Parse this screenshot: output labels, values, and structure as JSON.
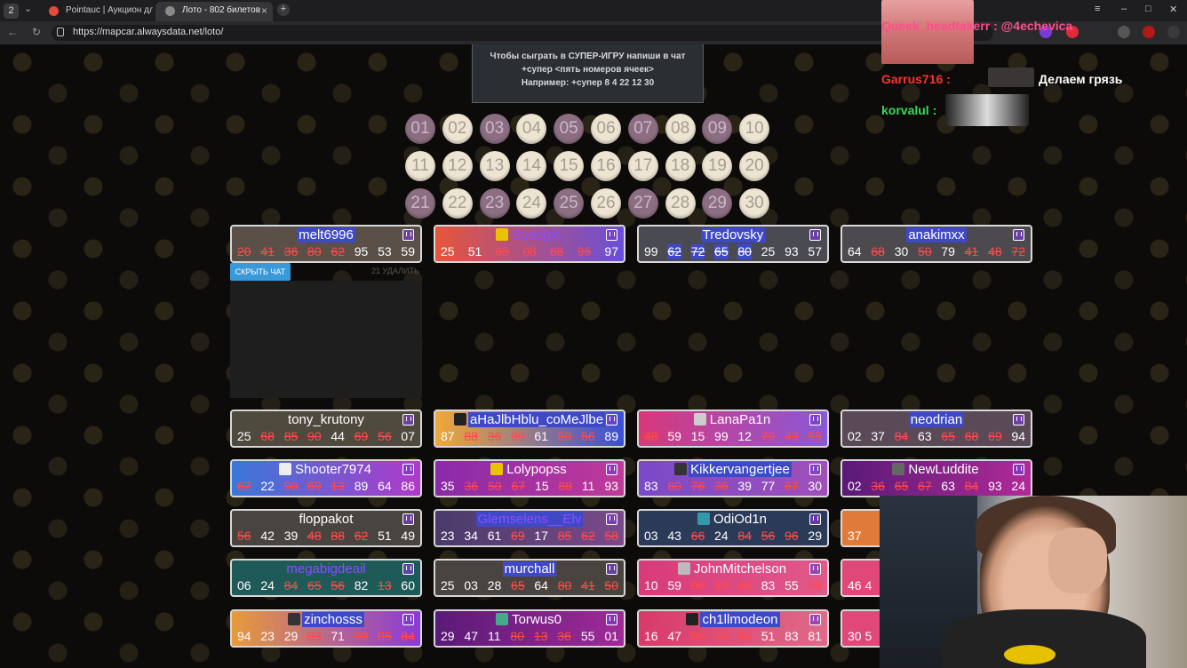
{
  "browser": {
    "tabs": [
      {
        "label": "Pointauc | Аукцион для с",
        "active": false
      },
      {
        "label": "Лото - 802 билетов",
        "active": true
      }
    ],
    "url": "https://mapcar.alwaysdata.net/loto/",
    "window_badge": "2"
  },
  "banner": {
    "line1": "Чтобы сыграть в СУПЕР-ИГРУ напиши в чат",
    "line2": "+супер <пять номеров ячеек>",
    "line3": "Например: +супер 8 4 22 12 30"
  },
  "balls": [
    {
      "n": "01",
      "used": true
    },
    {
      "n": "02",
      "used": false
    },
    {
      "n": "03",
      "used": true
    },
    {
      "n": "04",
      "used": false
    },
    {
      "n": "05",
      "used": true
    },
    {
      "n": "06",
      "used": false
    },
    {
      "n": "07",
      "used": true
    },
    {
      "n": "08",
      "used": false
    },
    {
      "n": "09",
      "used": true
    },
    {
      "n": "10",
      "used": false
    },
    {
      "n": "11",
      "used": false
    },
    {
      "n": "12",
      "used": false
    },
    {
      "n": "13",
      "used": false
    },
    {
      "n": "14",
      "used": false
    },
    {
      "n": "15",
      "used": false
    },
    {
      "n": "16",
      "used": false
    },
    {
      "n": "17",
      "used": false
    },
    {
      "n": "18",
      "used": false
    },
    {
      "n": "19",
      "used": false
    },
    {
      "n": "20",
      "used": false
    },
    {
      "n": "21",
      "used": true
    },
    {
      "n": "22",
      "used": false
    },
    {
      "n": "23",
      "used": true
    },
    {
      "n": "24",
      "used": false
    },
    {
      "n": "25",
      "used": true
    },
    {
      "n": "26",
      "used": false
    },
    {
      "n": "27",
      "used": true
    },
    {
      "n": "28",
      "used": false
    },
    {
      "n": "29",
      "used": true
    },
    {
      "n": "30",
      "used": false
    }
  ],
  "chat_controls": {
    "hide_label": "СКРЫТЬ ЧАТ",
    "delete_label": "21 УДАЛИТЬ"
  },
  "cards": [
    {
      "name": "melt6996",
      "bg": "#5a5048",
      "hl": true,
      "nums": [
        [
          "20",
          "x"
        ],
        [
          "41",
          "x"
        ],
        [
          "36",
          "x"
        ],
        [
          "80",
          "x"
        ],
        [
          "62",
          "x"
        ],
        [
          "95",
          ""
        ],
        [
          "53",
          ""
        ],
        [
          "59",
          ""
        ]
      ]
    },
    {
      "name": "Buedgio",
      "bg": "linear-gradient(90deg,#e8553a,#6a4fd8)",
      "dark": true,
      "av": "#e8c400",
      "nums": [
        [
          "25",
          ""
        ],
        [
          "51",
          ""
        ],
        [
          "65",
          "x"
        ],
        [
          "08",
          "x"
        ],
        [
          "68",
          "x"
        ],
        [
          "95",
          "x"
        ],
        [
          "97",
          ""
        ]
      ]
    },
    {
      "name": "Tredovsky",
      "bg": "#4a4a52",
      "hl": true,
      "nums": [
        [
          "99",
          ""
        ],
        [
          "62",
          "u"
        ],
        [
          "72",
          "u"
        ],
        [
          "65",
          "u"
        ],
        [
          "80",
          "u"
        ],
        [
          "25",
          ""
        ],
        [
          "93",
          ""
        ],
        [
          "57",
          ""
        ]
      ]
    },
    {
      "name": "anakimxx",
      "bg": "#4c4a4f",
      "hl": true,
      "nums": [
        [
          "64",
          ""
        ],
        [
          "68",
          "x"
        ],
        [
          "30",
          ""
        ],
        [
          "50",
          "x"
        ],
        [
          "79",
          ""
        ],
        [
          "41",
          "x"
        ],
        [
          "48",
          "x"
        ],
        [
          "72",
          "x"
        ]
      ]
    },
    {
      "name": "tony_krutony",
      "bg": "#4f4a3e",
      "nums": [
        [
          "25",
          ""
        ],
        [
          "68",
          "x"
        ],
        [
          "85",
          "x"
        ],
        [
          "90",
          "x"
        ],
        [
          "44",
          ""
        ],
        [
          "69",
          "x"
        ],
        [
          "56",
          "x"
        ],
        [
          "07",
          ""
        ]
      ]
    },
    {
      "name": "aHaJlbHblu_coMeJlbe",
      "bg": "linear-gradient(90deg,#f0a83a,#3a4fd8)",
      "hl": true,
      "av": "#222",
      "nums": [
        [
          "87",
          ""
        ],
        [
          "88",
          "x"
        ],
        [
          "36",
          "x"
        ],
        [
          "90",
          "x"
        ],
        [
          "61",
          ""
        ],
        [
          "50",
          "x"
        ],
        [
          "56",
          "x"
        ],
        [
          "89",
          ""
        ]
      ]
    },
    {
      "name": "LanaPa1n",
      "bg": "linear-gradient(90deg,#d8387a,#8a58d8)",
      "av": "#ccc",
      "nums": [
        [
          "48",
          "x"
        ],
        [
          "59",
          ""
        ],
        [
          "15",
          ""
        ],
        [
          "99",
          ""
        ],
        [
          "12",
          ""
        ],
        [
          "70",
          "x"
        ],
        [
          "43",
          "x"
        ],
        [
          "55",
          "x"
        ]
      ]
    },
    {
      "name": "neodrian",
      "bg": "#5a4a58",
      "hl": true,
      "nums": [
        [
          "02",
          ""
        ],
        [
          "37",
          ""
        ],
        [
          "84",
          "x"
        ],
        [
          "63",
          ""
        ],
        [
          "65",
          "x"
        ],
        [
          "68",
          "x"
        ],
        [
          "69",
          "x"
        ],
        [
          "94",
          ""
        ]
      ]
    },
    {
      "name": "Shooter7974",
      "bg": "linear-gradient(90deg,#3a78d8,#b03ac8)",
      "av": "#eee",
      "nums": [
        [
          "62",
          "x"
        ],
        [
          "22",
          ""
        ],
        [
          "90",
          "x"
        ],
        [
          "69",
          "x"
        ],
        [
          "13",
          "x"
        ],
        [
          "89",
          ""
        ],
        [
          "64",
          ""
        ],
        [
          "86",
          ""
        ]
      ]
    },
    {
      "name": "Lolypopss",
      "bg": "linear-gradient(90deg,#8a2aa8,#c03a9a)",
      "av": "#e8c400",
      "nums": [
        [
          "35",
          ""
        ],
        [
          "36",
          "x"
        ],
        [
          "50",
          "x"
        ],
        [
          "67",
          "x"
        ],
        [
          "15",
          ""
        ],
        [
          "88",
          "x"
        ],
        [
          "11",
          ""
        ],
        [
          "93",
          ""
        ]
      ]
    },
    {
      "name": "Kikkervangertjee",
      "bg": "linear-gradient(90deg,#7a4ac8,#a050b8)",
      "hl": true,
      "av": "#333",
      "nums": [
        [
          "83",
          ""
        ],
        [
          "80",
          "x"
        ],
        [
          "76",
          "x"
        ],
        [
          "36",
          "x"
        ],
        [
          "39",
          ""
        ],
        [
          "77",
          ""
        ],
        [
          "67",
          "x"
        ],
        [
          "30",
          ""
        ]
      ]
    },
    {
      "name": "NewLuddite",
      "bg": "linear-gradient(90deg,#5a1a78,#b02a98)",
      "av": "#666",
      "nums": [
        [
          "02",
          ""
        ],
        [
          "36",
          "x"
        ],
        [
          "65",
          "x"
        ],
        [
          "67",
          "x"
        ],
        [
          "63",
          ""
        ],
        [
          "84",
          "x"
        ],
        [
          "93",
          ""
        ],
        [
          "24",
          ""
        ]
      ]
    },
    {
      "name": "floppakot",
      "bg": "#4a4440",
      "nums": [
        [
          "56",
          "x"
        ],
        [
          "42",
          ""
        ],
        [
          "39",
          ""
        ],
        [
          "48",
          "x"
        ],
        [
          "88",
          "x"
        ],
        [
          "62",
          "x"
        ],
        [
          "51",
          ""
        ],
        [
          "49",
          ""
        ]
      ]
    },
    {
      "name": "Glemselens__Elv",
      "bg": "linear-gradient(90deg,#4a3a6a,#7a4a8a)",
      "hl": true,
      "dark": true,
      "nums": [
        [
          "23",
          ""
        ],
        [
          "34",
          ""
        ],
        [
          "61",
          ""
        ],
        [
          "69",
          "x"
        ],
        [
          "17",
          ""
        ],
        [
          "85",
          "x"
        ],
        [
          "62",
          "x"
        ],
        [
          "58",
          "x"
        ]
      ]
    },
    {
      "name": "OdiOd1n",
      "bg": "#2a3a58",
      "av": "#39a",
      "nums": [
        [
          "03",
          ""
        ],
        [
          "43",
          ""
        ],
        [
          "66",
          "x"
        ],
        [
          "24",
          ""
        ],
        [
          "84",
          "x"
        ],
        [
          "56",
          "x"
        ],
        [
          "96",
          "x"
        ],
        [
          "29",
          ""
        ]
      ]
    },
    {
      "name": "megabigdeail",
      "bg": "#1e5a58",
      "dark": true,
      "nums": [
        [
          "06",
          ""
        ],
        [
          "24",
          ""
        ],
        [
          "84",
          "x"
        ],
        [
          "65",
          "x"
        ],
        [
          "56",
          "x"
        ],
        [
          "82",
          ""
        ],
        [
          "13",
          "x"
        ],
        [
          "60",
          ""
        ]
      ]
    },
    {
      "name": "murchall",
      "bg": "#4a4440",
      "hl": true,
      "nums": [
        [
          "25",
          ""
        ],
        [
          "03",
          ""
        ],
        [
          "28",
          ""
        ],
        [
          "65",
          "x"
        ],
        [
          "64",
          ""
        ],
        [
          "80",
          "x"
        ],
        [
          "41",
          "x"
        ],
        [
          "50",
          "x"
        ]
      ]
    },
    {
      "name": "JohnMitchelson",
      "bg": "linear-gradient(90deg,#d83a7a,#e05a8a)",
      "av": "#bbb",
      "nums": [
        [
          "10",
          ""
        ],
        [
          "59",
          ""
        ],
        [
          "90",
          "x"
        ],
        [
          "13",
          "x"
        ],
        [
          "40",
          "x"
        ],
        [
          "83",
          ""
        ],
        [
          "55",
          ""
        ],
        [
          "09",
          "x"
        ]
      ]
    },
    {
      "name": "zinchosss",
      "bg": "linear-gradient(90deg,#e89a3a,#8a3ad8)",
      "hl": true,
      "av": "#333",
      "nums": [
        [
          "94",
          ""
        ],
        [
          "23",
          ""
        ],
        [
          "29",
          ""
        ],
        [
          "33",
          "x"
        ],
        [
          "71",
          ""
        ],
        [
          "90",
          "x"
        ],
        [
          "85",
          "x"
        ],
        [
          "84",
          "x"
        ]
      ]
    },
    {
      "name": "Torwus0",
      "bg": "linear-gradient(90deg,#5a1a78,#a02a98)",
      "av": "#4a8",
      "nums": [
        [
          "29",
          ""
        ],
        [
          "47",
          ""
        ],
        [
          "11",
          ""
        ],
        [
          "80",
          "x"
        ],
        [
          "13",
          "x"
        ],
        [
          "36",
          "x"
        ],
        [
          "55",
          ""
        ],
        [
          "01",
          ""
        ]
      ]
    },
    {
      "name": "ch1llmodeon",
      "bg": "linear-gradient(90deg,#d83a6a,#e06a8a)",
      "hl": true,
      "av": "#222",
      "nums": [
        [
          "16",
          ""
        ],
        [
          "47",
          ""
        ],
        [
          "08",
          "x"
        ],
        [
          "70",
          "x"
        ],
        [
          "66",
          "x"
        ],
        [
          "51",
          ""
        ],
        [
          "83",
          ""
        ],
        [
          "81",
          ""
        ]
      ]
    }
  ],
  "partial_cards": [
    {
      "nums": "37"
    },
    {
      "nums": "46 4"
    },
    {
      "nums": "30 5"
    }
  ],
  "overlay": {
    "chat": [
      {
        "user": "Queek_headtakerr :",
        "msg": "@4echevica",
        "user_color": "#ff4c8c",
        "msg_color": "#ff4c8c"
      },
      {
        "user": "Garrus716 :",
        "msg": "Делаем грязь",
        "user_color": "#ff3030",
        "msg_color": "#ffffff"
      },
      {
        "user": "korvalul :",
        "msg": "",
        "user_color": "#3ad85a",
        "msg_color": "#ffffff"
      }
    ]
  }
}
